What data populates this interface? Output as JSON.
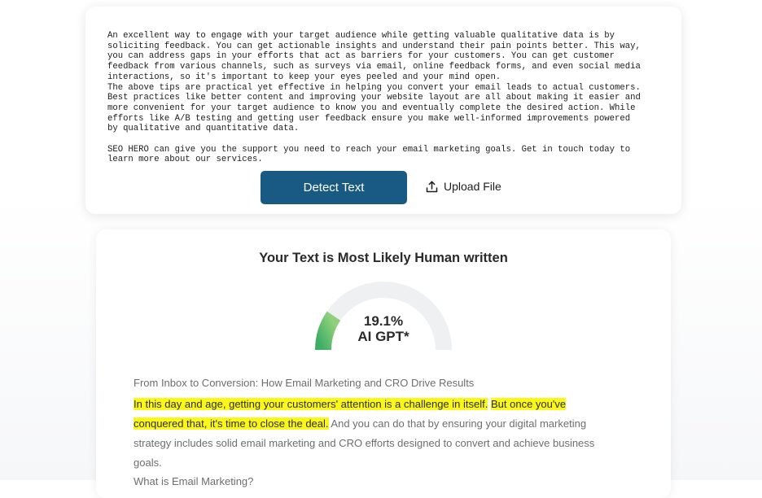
{
  "input": {
    "text": "An excellent way to engage with your target audience while getting valuable qualitative data is by\nsoliciting feedback. You can get actionable insights and understand their pain points better. This way,\nyou can address gaps in your efforts that act as barriers for your customers. You can get customer\nfeedback from various channels, such as surveys via email, online feedback forms, and even social media\ninteractions, so it's important to keep your eyes peeled and your mind open.\nThe above tips are practical yet effective in helping you convert your email leads to actual customers.\nBest practices like better content and improving your website layout are all about making it easier and\nmore convenient for your target audience to know you and eventually complete the desired action. While\nefforts like A/B testing and getting user feedback ensure you make well-informed improvements powered\nby qualitative and quantitative data.\n\nSEO HERO can give you the support you need to reach your email marketing goals. Get in touch today to\nlearn more about our services."
  },
  "actions": {
    "detect_label": "Detect Text",
    "upload_label": "Upload File",
    "upload_icon": "upload-icon"
  },
  "result": {
    "title": "Your Text is Most Likely Human written",
    "percentage": "19.1%",
    "percentage_value": 19.1,
    "label": "AI GPT*",
    "gauge_colors": {
      "track": "#eff0f2",
      "fill_start": "#8fd07c",
      "fill_end": "#3fae64"
    }
  },
  "analysis": {
    "heading": "From Inbox to Conversion: How Email Marketing and CRO Drive Results",
    "highlight_1": "In this day and age, getting your customers' attention is a challenge in itself.",
    "highlight_2a": "But once you've",
    "highlight_2b": "conquered that, it's time to close the deal.",
    "rest": "And you can do that by ensuring your digital marketing strategy includes solid email marketing and CRO efforts designed to convert and achieve business goals.",
    "next_heading": "What is Email Marketing?",
    "highlight_color": "#fbf717"
  }
}
